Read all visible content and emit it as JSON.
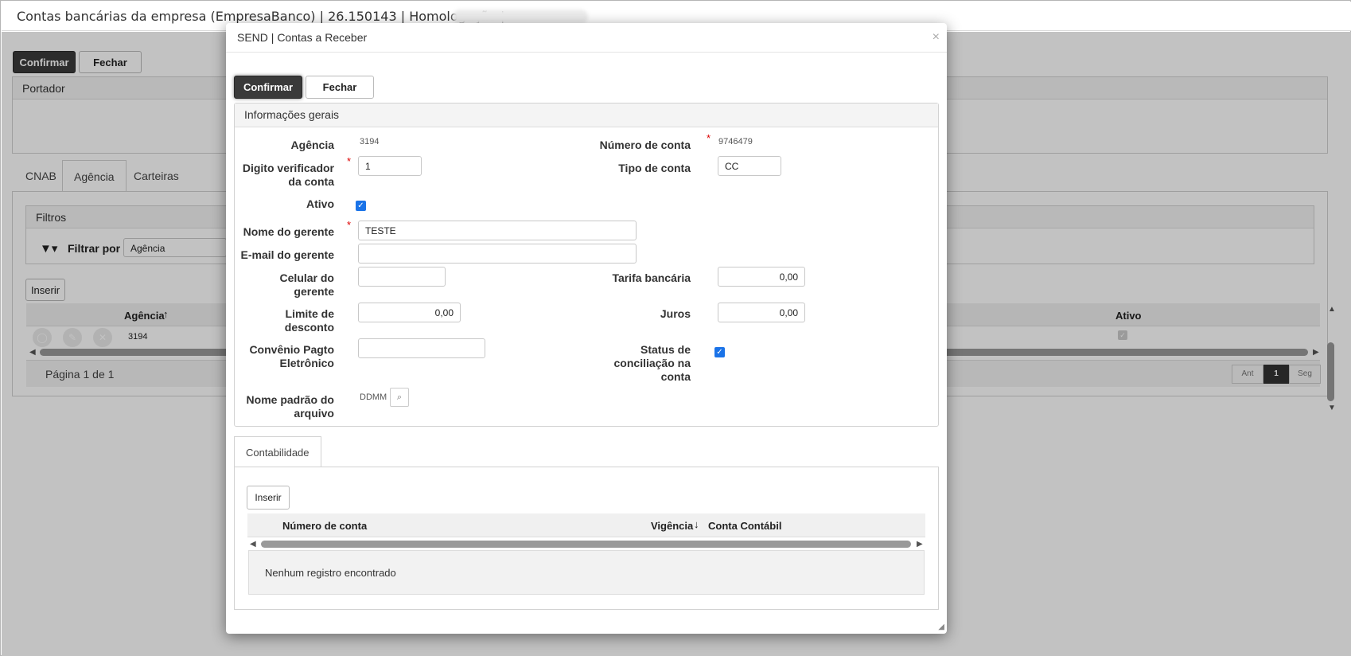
{
  "window": {
    "title": "Contas bancárias da empresa (EmpresaBanco) | 26.150143 | Homologação |"
  },
  "background": {
    "confirm_label": "Confirmar",
    "close_label": "Fechar",
    "portador_label": "Portador",
    "tabs": [
      "CNAB",
      "Agência",
      "Carteiras"
    ],
    "filters_title": "Filtros",
    "filter_by_label": "Filtrar por",
    "filter_value": "Agência",
    "insert_label": "Inserir",
    "grid_headers": {
      "agencia": "Agência",
      "ativo": "Ativo"
    },
    "grid_rows": [
      {
        "agencia": "3194"
      }
    ],
    "pagination": {
      "text": "Página 1 de 1",
      "prev": "Ant",
      "current": "1",
      "next": "Seg"
    }
  },
  "modal": {
    "title": "SEND | Contas a Receber",
    "close_glyph": "×",
    "confirm_label": "Confirmar",
    "close_label": "Fechar",
    "section_title": "Informações gerais",
    "fields": {
      "agencia": {
        "label": "Agência",
        "value": "3194"
      },
      "numero_conta": {
        "label": "Número de conta",
        "value": "9746479"
      },
      "digito": {
        "label_line1": "Digito verificador",
        "label_line2": "da conta",
        "value": "1"
      },
      "tipo_conta": {
        "label": "Tipo de conta",
        "value": "CC"
      },
      "ativo": {
        "label": "Ativo",
        "checked": true
      },
      "nome_gerente": {
        "label": "Nome do gerente",
        "value": "TESTE"
      },
      "email_gerente": {
        "label": "E-mail do gerente",
        "value": ""
      },
      "celular_gerente": {
        "label_line1": "Celular do",
        "label_line2": "gerente",
        "value": ""
      },
      "tarifa": {
        "label": "Tarifa bancária",
        "value": "0,00"
      },
      "limite_desconto": {
        "label_line1": "Limite de",
        "label_line2": "desconto",
        "value": "0,00"
      },
      "juros": {
        "label": "Juros",
        "value": "0,00"
      },
      "convenio": {
        "label_line1": "Convênio Pagto",
        "label_line2": "Eletrônico",
        "value": ""
      },
      "status_conciliacao": {
        "label_line1": "Status de",
        "label_line2": "conciliação na",
        "label_line3": "conta",
        "checked": true
      },
      "nome_arquivo": {
        "label_line1": "Nome padrão do",
        "label_line2": "arquivo",
        "value": "DDMM"
      }
    },
    "contab": {
      "tab_label": "Contabilidade",
      "insert_label": "Inserir",
      "headers": {
        "numero_conta": "Número de conta",
        "vigencia": "Vigência",
        "conta_contabil": "Conta Contábil"
      },
      "empty_text": "Nenhum registro encontrado"
    }
  },
  "colors": {
    "accent_checkbox": "#1a73e8",
    "required": "#dd0000",
    "dark_button": "#3a3a3a"
  }
}
